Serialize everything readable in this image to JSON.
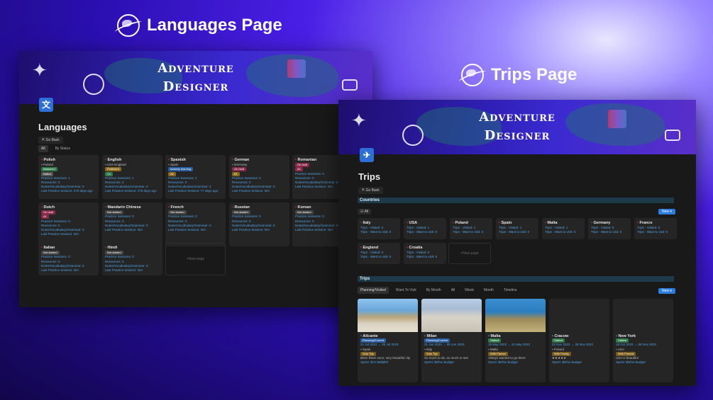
{
  "labels": {
    "languages_page": "Languages Page",
    "trips_page": "Trips Page"
  },
  "banner": {
    "line1": "Adventure",
    "line2": "Designer"
  },
  "languages": {
    "title": "Languages",
    "go_back": "Go Back",
    "tabs": [
      "All",
      "By Status"
    ],
    "new_page": "New page",
    "cards": [
      {
        "name": "Polish",
        "country": "Poland",
        "status": "Mastered",
        "level": "Native",
        "l1": "Practice Sessions: 1",
        "l2": "Resources: 0",
        "l3": "Notes/Vocabulary/Grammar: 0",
        "l4": "Last Practice Session: 275 days ago"
      },
      {
        "name": "English",
        "country": "USA  England",
        "status": "Proficient",
        "level": "C1",
        "l1": "Practice Sessions: 1",
        "l2": "Resources: 2",
        "l3": "Notes/Vocabulary/Grammar: 0",
        "l4": "Last Practice Session: 275 days ago"
      },
      {
        "name": "Spanish",
        "country": "Spain",
        "status": "Actively learning",
        "level": "A2",
        "l1": "Practice Sessions: 1",
        "l2": "Resources: 0",
        "l3": "Notes/Vocabulary/Grammar: 2",
        "l4": "Last Practice Session: 77 days ago"
      },
      {
        "name": "German",
        "country": "Germany",
        "status": "On hold",
        "level": "B1",
        "l1": "Practice Sessions: 0",
        "l2": "Resources: 0",
        "l3": "Notes/Vocabulary/Grammar: 0",
        "l4": "Last Practice Session: N/A"
      },
      {
        "name": "Romanian",
        "country": "",
        "status": "On hold",
        "level": "A1",
        "l1": "Practice Sessions: 0",
        "l2": "Resources: 0",
        "l3": "Notes/Vocabulary/Grammar: 0",
        "l4": "Last Practice Session: N/A"
      },
      {
        "name": "Dutch",
        "country": "",
        "status": "On hold",
        "level": "A1",
        "l1": "Practice Sessions: 0",
        "l2": "Resources: 0",
        "l3": "Notes/Vocabulary/Grammar: 0",
        "l4": "Last Practice Session: N/A"
      },
      {
        "name": "Mandarin Chinese",
        "country": "",
        "status": "Not started",
        "level": "",
        "l1": "Practice Sessions: 0",
        "l2": "Resources: 0",
        "l3": "Notes/Vocabulary/Grammar: 0",
        "l4": "Last Practice Session: N/A"
      },
      {
        "name": "French",
        "country": "",
        "status": "Not started",
        "level": "",
        "l1": "Practice Sessions: 0",
        "l2": "Resources: 0",
        "l3": "Notes/Vocabulary/Grammar: 0",
        "l4": "Last Practice Session: N/A"
      },
      {
        "name": "Russian",
        "country": "",
        "status": "Not started",
        "level": "",
        "l1": "Practice Sessions: 0",
        "l2": "Resources: 0",
        "l3": "Notes/Vocabulary/Grammar: 0",
        "l4": "Last Practice Session: N/A"
      },
      {
        "name": "Korean",
        "country": "",
        "status": "Not started",
        "level": "",
        "l1": "Practice Sessions: 0",
        "l2": "Resources: 0",
        "l3": "Notes/Vocabulary/Grammar: 0",
        "l4": "Last Practice Session: N/A"
      },
      {
        "name": "Italian",
        "country": "",
        "status": "Not started",
        "level": "",
        "l1": "Practice Sessions: 0",
        "l2": "Resources: 0",
        "l3": "Notes/Vocabulary/Grammar: 0",
        "l4": "Last Practice Session: N/A"
      },
      {
        "name": "Hindi",
        "country": "",
        "status": "Not started",
        "level": "",
        "l1": "Practice Sessions: 0",
        "l2": "Resources: 0",
        "l3": "Notes/Vocabulary/Grammar: 0",
        "l4": "Last Practice Session: N/A"
      }
    ]
  },
  "trips": {
    "title": "Trips",
    "go_back": "Go Back",
    "countries_header": "Countries",
    "all": "All",
    "new": "New",
    "new_page": "New page",
    "countries": [
      {
        "name": "Italy",
        "visited": "Trips - Visited: 2",
        "want": "Trips - Want to visit: 0"
      },
      {
        "name": "USA",
        "visited": "Trips - Visited: 1",
        "want": "Trips - Want to visit: 0"
      },
      {
        "name": "Poland",
        "visited": "Trips - Visited: 1",
        "want": "Trips - Want to visit: 0"
      },
      {
        "name": "Spain",
        "visited": "Trips - Visited: 1",
        "want": "Trips - Want to visit: 0"
      },
      {
        "name": "Malta",
        "visited": "Trips - Visited: 1",
        "want": "Trips - Want to visit: 0"
      },
      {
        "name": "Germany",
        "visited": "Trips - Visited: 0",
        "want": "Trips - Want to visit: 0"
      },
      {
        "name": "France",
        "visited": "Trips - Visited: 0",
        "want": "Trips - Want to visit: 0"
      },
      {
        "name": "England",
        "visited": "Trips - Visited: 0",
        "want": "Trips - Want to visit: 0"
      },
      {
        "name": "Croatia",
        "visited": "Trips - Visited: 0",
        "want": "Trips - Want to visit: 0"
      }
    ],
    "trips_header": "Trips",
    "trip_tabs": [
      "Planning/Visited",
      "Want To Visit",
      "By Month",
      "All",
      "Week",
      "Month",
      "Timeline"
    ],
    "trip_cards": [
      {
        "name": "Alicante",
        "status": "Planning/Current",
        "date": "21 Jul 2023 → 05 Jul 2023",
        "country": "Spain",
        "tag": "Solo Trip",
        "desc": "Been there once, very beautiful city",
        "spent": "Spent: $72.36/$800"
      },
      {
        "name": "Milan",
        "status": "Planning/Current",
        "date": "01 Jun 2023 → 09 Jun 2023",
        "country": "Italy",
        "tag": "Solo Trip",
        "desc": "So much to do, so much to see",
        "spent": "Spent: $0/No Budget"
      },
      {
        "name": "Malta",
        "status": "Visited",
        "date": "15 May 2023 → 21 May 2023",
        "country": "Malta",
        "tag": "With Partner",
        "desc": "Always wanted to go there",
        "spent": "Spent: $0/No Budget"
      },
      {
        "name": "Cracow",
        "status": "Visited",
        "date": "22 Nov 2022 → 28 Nov 2022",
        "country": "Poland",
        "tag": "With Family",
        "desc": "★★★★★",
        "spent": "Spent: $0/No Budget"
      },
      {
        "name": "New York",
        "status": "Visited",
        "date": "18 Oct 2022 → 08 Nov 2022",
        "country": "USA",
        "tag": "With Friends",
        "desc": "USA is beautiful",
        "spent": "Spent: $0/No Budget"
      }
    ]
  }
}
